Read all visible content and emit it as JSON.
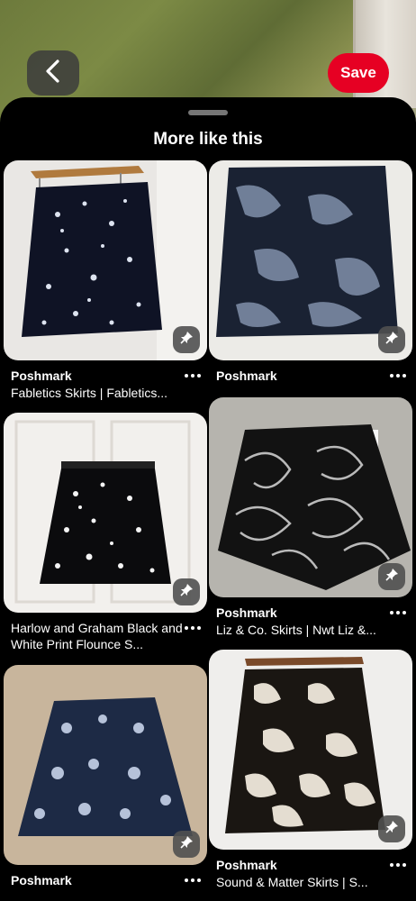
{
  "header": {
    "save_label": "Save"
  },
  "sheet": {
    "title": "More like this"
  },
  "pins": [
    {
      "source": "Poshmark",
      "description": "Fabletics Skirts | Fabletics..."
    },
    {
      "source": "Poshmark",
      "description": ""
    },
    {
      "source": "",
      "description": "Harlow and Graham Black and White Print Flounce S..."
    },
    {
      "source": "Poshmark",
      "description": "Liz & Co. Skirts | Nwt Liz &..."
    },
    {
      "source": "Poshmark",
      "description": ""
    },
    {
      "source": "Poshmark",
      "description": "Sound & Matter Skirts | S..."
    }
  ],
  "icons": {
    "back": "chevron-left-icon",
    "pin": "pin-icon",
    "more": "more-dots-icon"
  },
  "colors": {
    "save_button": "#e60023",
    "background": "#000000"
  }
}
